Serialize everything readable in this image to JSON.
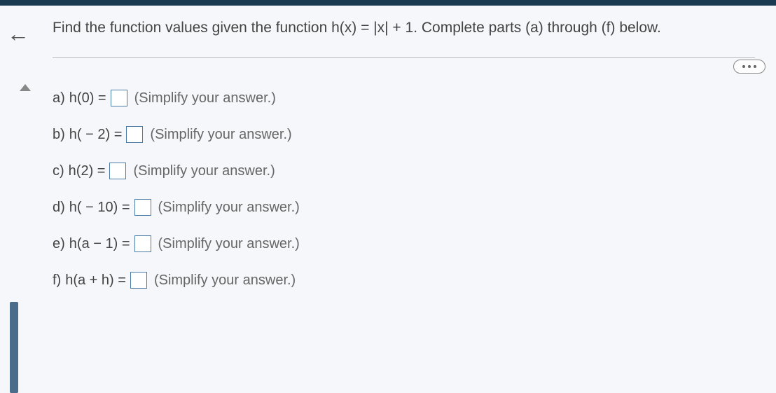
{
  "header": {
    "text": "Find the function values given the function h(x) = |x| + 1. Complete parts (a) through (f) below."
  },
  "questions": [
    {
      "label": "a)",
      "expr": "h(0) =",
      "hint": "(Simplify your answer.)"
    },
    {
      "label": "b)",
      "expr": "h( − 2) =",
      "hint": "(Simplify your answer.)"
    },
    {
      "label": "c)",
      "expr": "h(2) =",
      "hint": "(Simplify your answer.)"
    },
    {
      "label": "d)",
      "expr": "h( − 10) =",
      "hint": "(Simplify your answer.)"
    },
    {
      "label": "e)",
      "expr": "h(a − 1) =",
      "hint": "(Simplify your answer.)"
    },
    {
      "label": "f)",
      "expr": "h(a + h) =",
      "hint": "(Simplify your answer.)"
    }
  ]
}
